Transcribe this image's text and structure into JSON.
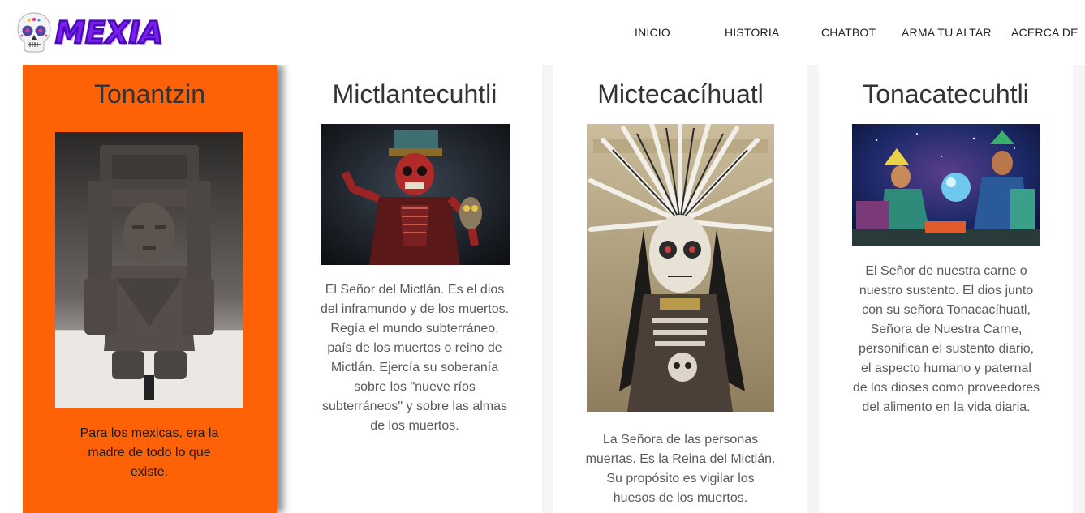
{
  "header": {
    "logo_text": "MEXIA",
    "logo_icon": "sugar-skull-icon",
    "nav": [
      {
        "label": "INICIO"
      },
      {
        "label": "HISTORIA"
      },
      {
        "label": "CHATBOT"
      },
      {
        "label": "ARMA TU ALTAR"
      },
      {
        "label": "ACERCA DE"
      }
    ]
  },
  "cards": [
    {
      "title": "Tonantzin",
      "image_subject": "stone-statue",
      "text": "Para los mexicas, era la madre de todo lo que existe."
    },
    {
      "title": "Mictlantecuhtli",
      "image_subject": "skeletal-god-with-owl",
      "text": "El Señor del Mictlán. Es el dios del inframundo y de los muertos. Regía el mundo subterráneo, país de los muertos o reino de Mictlán. Ejercía su soberanía sobre los \"nueve ríos subterráneos\" y sobre las almas de los muertos."
    },
    {
      "title": "Mictecacíhuatl",
      "image_subject": "feathered-skull-goddess",
      "text": "La Señora de las personas muertas. Es la Reina del Mictlán. Su propósito es vigilar los huesos de los muertos."
    },
    {
      "title": "Tonacatecuhtli",
      "image_subject": "two-deities-cosmic-scene",
      "text": "El Señor de nuestra carne o nuestro sustento. El dios junto con su señora Tonacacíhuatl, Señora de Nuestra Carne, personifican el sustento diario, el aspecto humano y paternal de los dioses como proveedores del alimento en la vida diaria."
    }
  ],
  "colors": {
    "accent_orange": "#ff6107",
    "logo_purple": "#7a1ff0"
  }
}
